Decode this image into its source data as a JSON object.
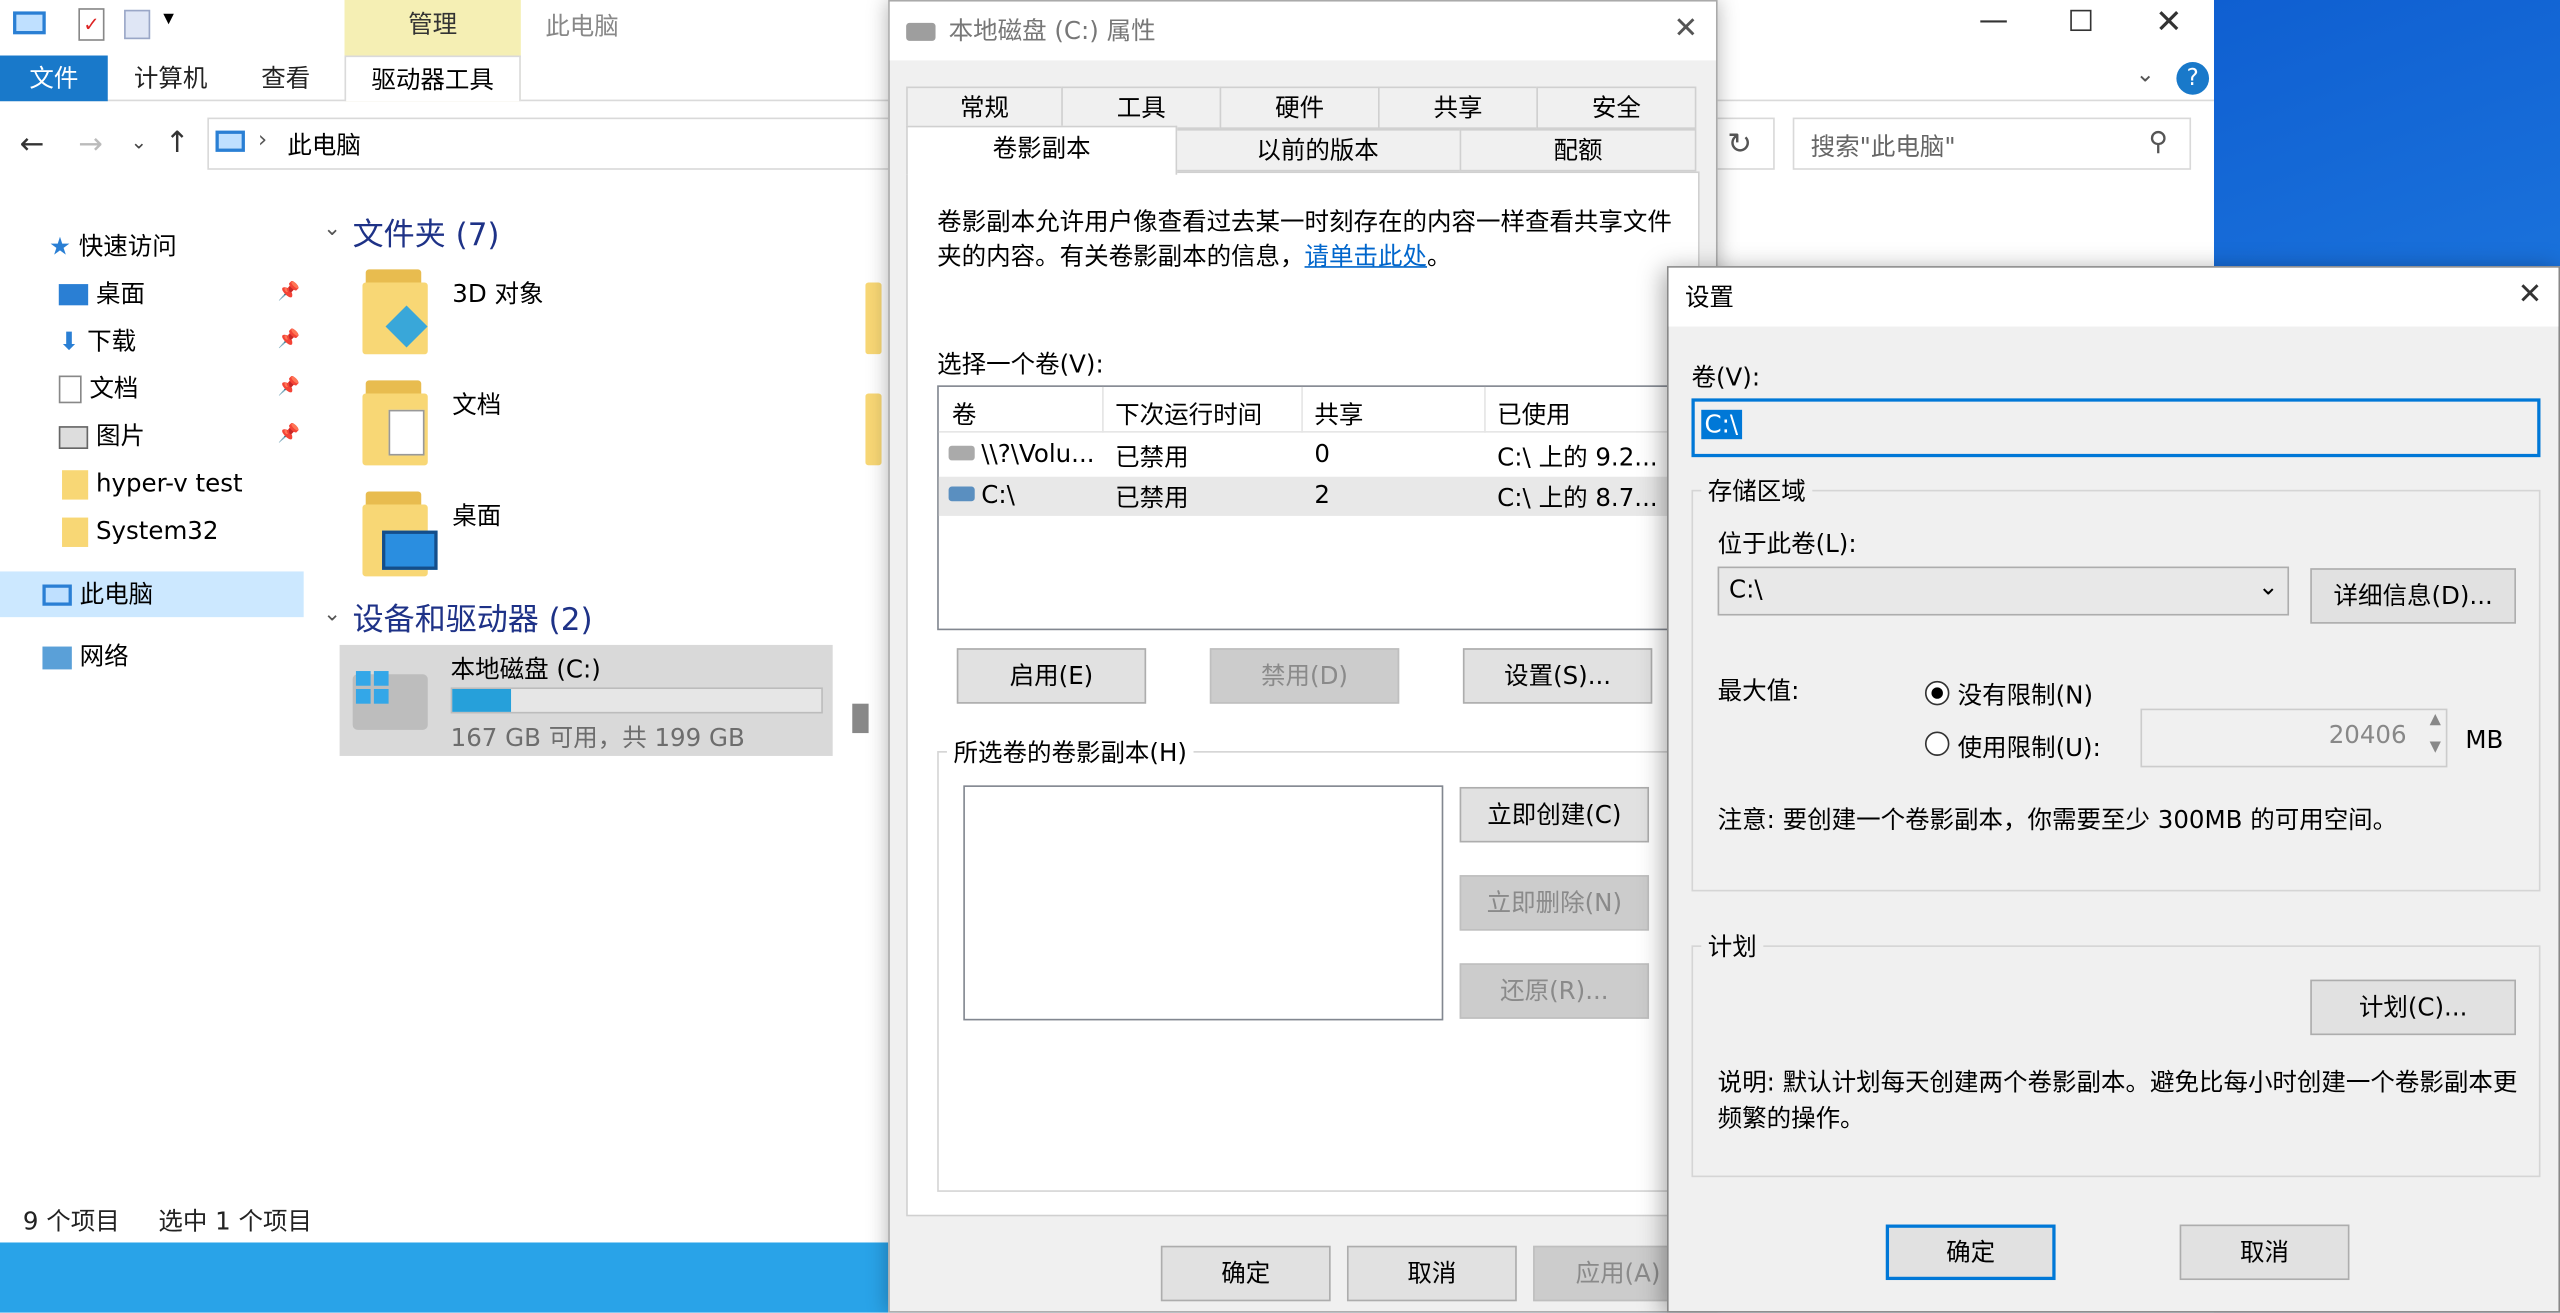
{
  "explorer": {
    "ribbon_tabs": [
      "文件",
      "计算机",
      "查看",
      "驱动器工具"
    ],
    "context_label": "管理",
    "window_title": "此电脑",
    "address": "此电脑",
    "search_placeholder": "搜索\"此电脑\"",
    "nav": {
      "quick_access": "快速访问",
      "items": [
        "桌面",
        "下载",
        "文档",
        "图片",
        "hyper-v test",
        "System32"
      ],
      "this_pc": "此电脑",
      "network": "网络"
    },
    "folders_header": "文件夹 (7)",
    "folders": [
      "3D 对象",
      "文档",
      "桌面"
    ],
    "devices_header": "设备和驱动器 (2)",
    "drive": {
      "name": "本地磁盘 (C:)",
      "free_text": "167 GB 可用，共 199 GB",
      "used_fraction": 0.16
    },
    "status": {
      "count": "9 个项目",
      "selected": "选中 1 个项目"
    }
  },
  "props": {
    "title": "本地磁盘 (C:) 属性",
    "tabs_row1": [
      "常规",
      "工具",
      "硬件",
      "共享",
      "安全"
    ],
    "tabs_row2": [
      "卷影副本",
      "以前的版本",
      "配额"
    ],
    "desc": "卷影副本允许用户像查看过去某一时刻存在的内容一样查看共享文件夹的内容。有关卷影副本的信息，",
    "link": "请单击此处",
    "desc_end": "。",
    "select_label": "选择一个卷(V):",
    "columns": [
      "卷",
      "下次运行时间",
      "共享",
      "已使用"
    ],
    "rows": [
      [
        "\\\\?\\Volu...",
        "已禁用",
        "0",
        "C:\\ 上的 9.2..."
      ],
      [
        "C:\\",
        "已禁用",
        "2",
        "C:\\ 上的 8.7..."
      ]
    ],
    "btn_enable": "启用(E)",
    "btn_disable": "禁用(D)",
    "btn_settings": "设置(S)...",
    "copies_label": "所选卷的卷影副本(H)",
    "btn_create": "立即创建(C)",
    "btn_delete": "立即删除(N)",
    "btn_restore": "还原(R)...",
    "btn_ok": "确定",
    "btn_cancel": "取消",
    "btn_apply": "应用(A)"
  },
  "settings": {
    "title": "设置",
    "volume_label": "卷(V):",
    "volume_value": "C:\\",
    "storage_group": "存储区域",
    "located_label": "位于此卷(L):",
    "located_value": "C:\\",
    "details_btn": "详细信息(D)...",
    "max_label": "最大值:",
    "no_limit": "没有限制(N)",
    "use_limit": "使用限制(U):",
    "limit_value": "20406",
    "unit": "MB",
    "note": "注意: 要创建一个卷影副本，你需要至少 300MB 的可用空间。",
    "schedule_group": "计划",
    "schedule_btn": "计划(C)...",
    "schedule_note": "说明: 默认计划每天创建两个卷影副本。避免比每小时创建一个卷影副本更频繁的操作。",
    "ok": "确定",
    "cancel": "取消"
  },
  "colors": {
    "accent": "#0078d7",
    "file_tab": "#1979ca",
    "taskbar": "#29a3e8",
    "link": "#0066cc"
  }
}
